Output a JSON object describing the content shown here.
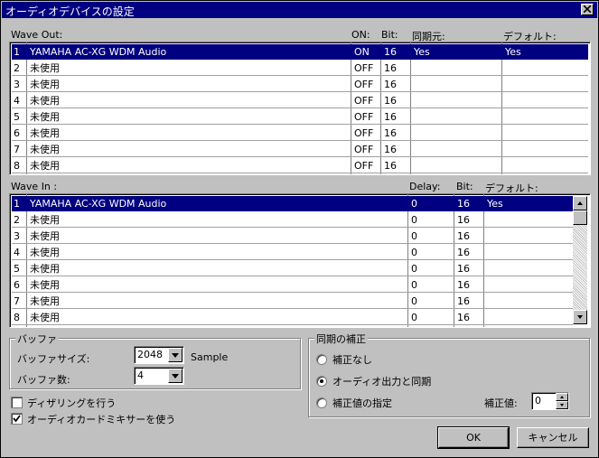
{
  "window": {
    "title": "オーディオデバイスの設定"
  },
  "wave_out": {
    "label": "Wave Out:",
    "headers": {
      "on": "ON:",
      "bit": "Bit:",
      "sync": "同期元:",
      "default": "デフォルト:"
    },
    "rows": [
      {
        "num": "1",
        "name": "YAMAHA AC-XG WDM Audio",
        "on": "ON",
        "bit": "16",
        "sync": "Yes",
        "default": "Yes"
      },
      {
        "num": "2",
        "name": "未使用",
        "on": "OFF",
        "bit": "16",
        "sync": "",
        "default": ""
      },
      {
        "num": "3",
        "name": "未使用",
        "on": "OFF",
        "bit": "16",
        "sync": "",
        "default": ""
      },
      {
        "num": "4",
        "name": "未使用",
        "on": "OFF",
        "bit": "16",
        "sync": "",
        "default": ""
      },
      {
        "num": "5",
        "name": "未使用",
        "on": "OFF",
        "bit": "16",
        "sync": "",
        "default": ""
      },
      {
        "num": "6",
        "name": "未使用",
        "on": "OFF",
        "bit": "16",
        "sync": "",
        "default": ""
      },
      {
        "num": "7",
        "name": "未使用",
        "on": "OFF",
        "bit": "16",
        "sync": "",
        "default": ""
      },
      {
        "num": "8",
        "name": "未使用",
        "on": "OFF",
        "bit": "16",
        "sync": "",
        "default": ""
      }
    ]
  },
  "wave_in": {
    "label": "Wave In :",
    "headers": {
      "delay": "Delay:",
      "bit": "Bit:",
      "default": "デフォルト:"
    },
    "rows": [
      {
        "num": "1",
        "name": "YAMAHA AC-XG WDM Audio",
        "delay": "0",
        "bit": "16",
        "default": "Yes"
      },
      {
        "num": "2",
        "name": "未使用",
        "delay": "0",
        "bit": "16",
        "default": ""
      },
      {
        "num": "3",
        "name": "未使用",
        "delay": "0",
        "bit": "16",
        "default": ""
      },
      {
        "num": "4",
        "name": "未使用",
        "delay": "0",
        "bit": "16",
        "default": ""
      },
      {
        "num": "5",
        "name": "未使用",
        "delay": "0",
        "bit": "16",
        "default": ""
      },
      {
        "num": "6",
        "name": "未使用",
        "delay": "0",
        "bit": "16",
        "default": ""
      },
      {
        "num": "7",
        "name": "未使用",
        "delay": "0",
        "bit": "16",
        "default": ""
      },
      {
        "num": "8",
        "name": "未使用",
        "delay": "0",
        "bit": "16",
        "default": ""
      }
    ]
  },
  "buffer": {
    "group_title": "バッファ",
    "size_label": "バッファサイズ:",
    "size_value": "2048",
    "size_unit": "Sample",
    "count_label": "バッファ数:",
    "count_value": "4"
  },
  "sync": {
    "group_title": "同期の補正",
    "option_none": "補正なし",
    "option_audio": "オーディオ出力と同期",
    "option_value": "補正値の指定",
    "correction_label": "補正値:",
    "correction_value": "0",
    "selected": "option_audio"
  },
  "checkboxes": {
    "dither": {
      "label": "ディザリングを行う",
      "checked": false
    },
    "mixer": {
      "label": "オーディオカードミキサーを使う",
      "checked": true
    }
  },
  "buttons": {
    "ok": "OK",
    "cancel": "キャンセル"
  }
}
